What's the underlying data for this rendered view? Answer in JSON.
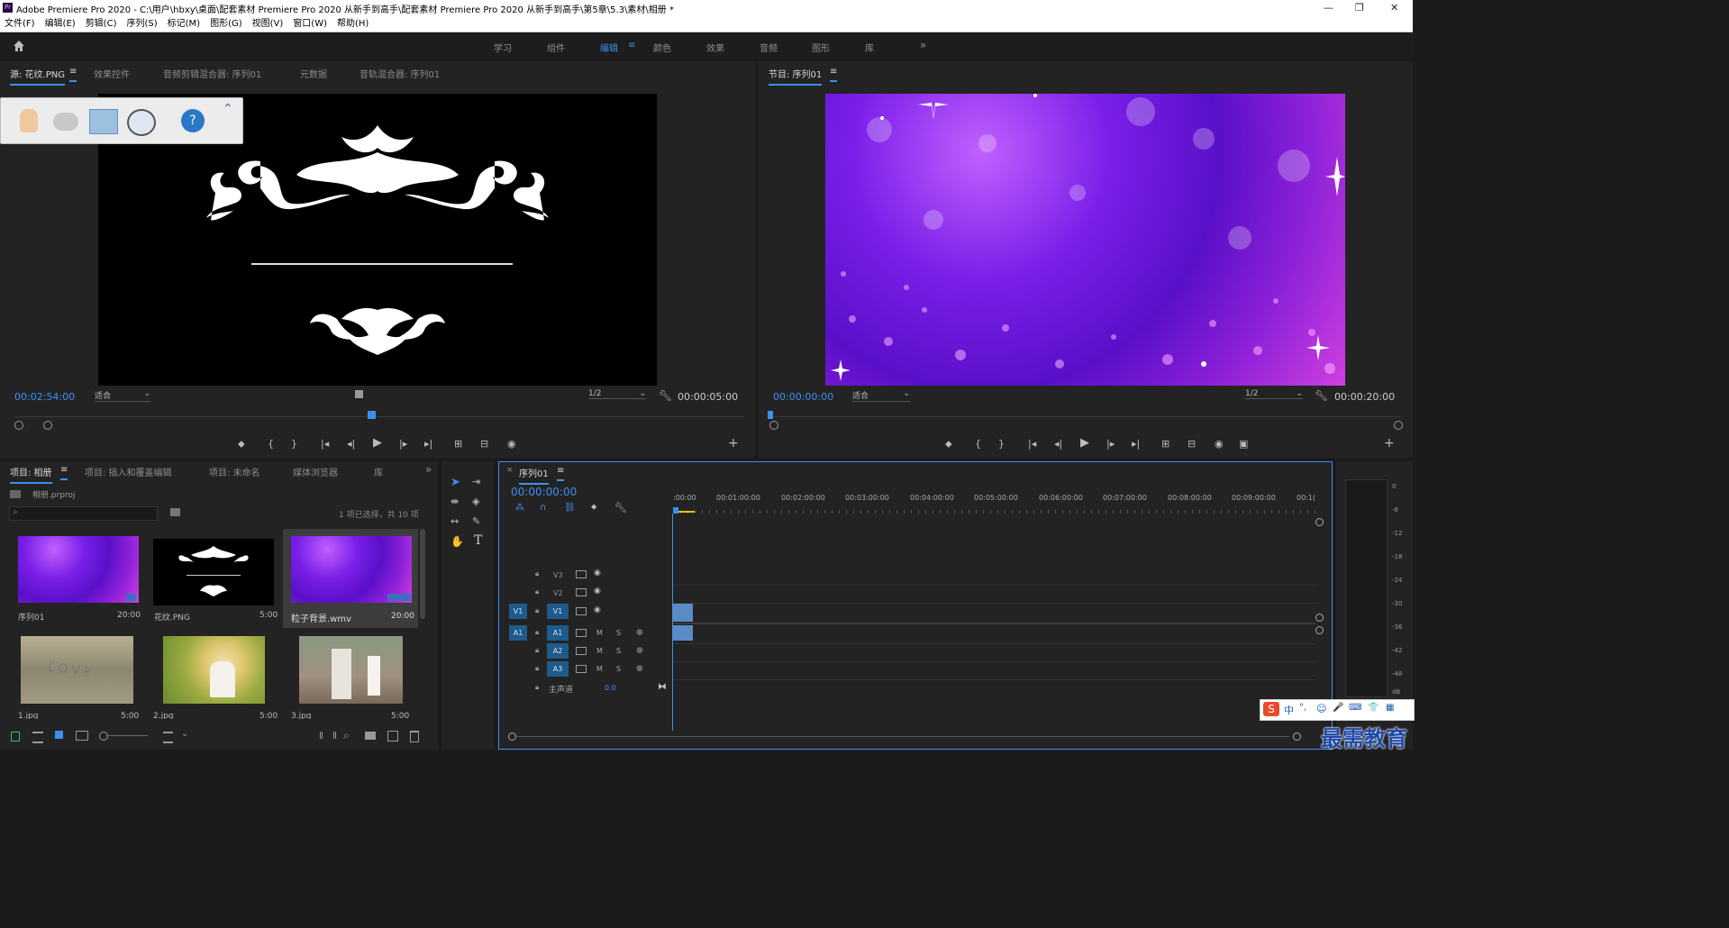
{
  "window": {
    "title": "Adobe Premiere Pro 2020 - C:\\用户\\hbxy\\桌面\\配套素材 Premiere Pro 2020 从新手到高手\\配套素材 Premiere Pro 2020 从新手到高手\\第5章\\5.3\\素材\\相册 *",
    "min": "—",
    "max": "❐",
    "close": "✕"
  },
  "menu": [
    "文件(F)",
    "编辑(E)",
    "剪辑(C)",
    "序列(S)",
    "标记(M)",
    "图形(G)",
    "视图(V)",
    "窗口(W)",
    "帮助(H)"
  ],
  "workspaces": [
    "学习",
    "组件",
    "编辑",
    "颜色",
    "效果",
    "音频",
    "图形",
    "库"
  ],
  "workspace_menu": "≡",
  "workspace_more": "»",
  "source": {
    "tabs": [
      "源: 花纹.PNG",
      "效果控件",
      "音频剪辑混合器: 序列01",
      "元数据",
      "音轨混合器: 序列01"
    ],
    "tab_menu": "≡",
    "timecode": "00:02:54:00",
    "fit": "适合",
    "resolution": "1/2",
    "duration": "00:00:05:00"
  },
  "program": {
    "tab": "节目: 序列01",
    "tab_menu": "≡",
    "timecode": "00:00:00:00",
    "fit": "适合",
    "resolution": "1/2",
    "duration": "00:00:20:00"
  },
  "transport_source": [
    "⬥",
    "{",
    "}",
    "|◂",
    "◂|",
    "▶",
    "|▸",
    "▸|",
    "⊞",
    "⊟",
    "◉"
  ],
  "transport_program": [
    "⬥",
    "{",
    "}",
    "|◂",
    "◂|",
    "▶",
    "|▸",
    "▸|",
    "⊞",
    "⊟",
    "◉",
    "▣"
  ],
  "add": "+",
  "project": {
    "tabs": [
      "项目: 相册",
      "项目: 插入和覆盖编辑",
      "项目: 未命名",
      "媒体浏览器",
      "库"
    ],
    "tab_menu": "≡",
    "more": "»",
    "file": "相册.prproj",
    "selection": "1 项已选择，共 10 项",
    "items": [
      {
        "name": "序列01",
        "dur": "20:00"
      },
      {
        "name": "花纹.PNG",
        "dur": "5:00"
      },
      {
        "name": "粒子背景.wmv",
        "dur": "20:00"
      },
      {
        "name": "1.jpg",
        "dur": "5:00"
      },
      {
        "name": "2.jpg",
        "dur": "5:00"
      },
      {
        "name": "3.jpg",
        "dur": "5:00"
      }
    ],
    "love_text": "LOVE"
  },
  "timeline": {
    "close": "×",
    "tab": "序列01",
    "tab_menu": "≡",
    "timecode": "00:00:00:00",
    "ruler": [
      ":00:00",
      "00:01:00:00",
      "00:02:00:00",
      "00:03:00:00",
      "00:04:00:00",
      "00:05:00:00",
      "00:06:00:00",
      "00:07:00:00",
      "00:08:00:00",
      "00:09:00:00",
      "00:1("
    ],
    "video_tracks": [
      "V3",
      "V2",
      "V1"
    ],
    "audio_tracks": [
      "A1",
      "A2",
      "A3"
    ],
    "src_v": "V1",
    "src_a": "A1",
    "mute": "M",
    "solo": "S",
    "master": "主声道",
    "master_value": "0.0"
  },
  "meter": [
    "0",
    "-6",
    "-12",
    "-18",
    "-24",
    "-30",
    "-36",
    "-42",
    "-48",
    "dB"
  ],
  "watermark": "最需教育",
  "ime": [
    "中",
    "°,",
    "☺",
    "🎤",
    "⌨",
    "👕",
    "▦"
  ],
  "ime_logo": "S",
  "tools": {
    "text": "T"
  },
  "help_glyph": "?",
  "colors": {
    "accent": "#3d8ff0",
    "track_active": "#1e5a8a",
    "panel": "#232323",
    "bg": "#1b1b1b",
    "clip": "#5b8bc4"
  }
}
